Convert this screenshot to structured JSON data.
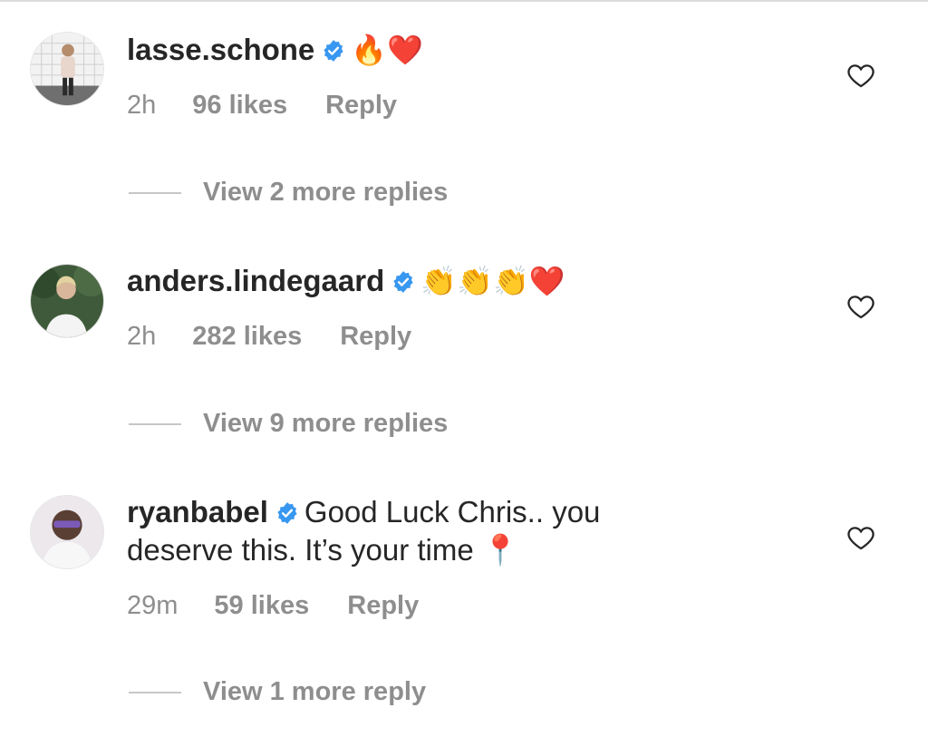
{
  "comments": [
    {
      "username": "lasse.schone",
      "verified": true,
      "text": "🔥❤️",
      "time": "2h",
      "likes": "96 likes",
      "reply_label": "Reply",
      "view_replies": "View 2 more replies"
    },
    {
      "username": "anders.lindegaard",
      "verified": true,
      "text": "👏👏👏❤️",
      "time": "2h",
      "likes": "282 likes",
      "reply_label": "Reply",
      "view_replies": "View 9 more replies"
    },
    {
      "username": "ryanbabel",
      "verified": true,
      "text": "Good Luck Chris.. you deserve this. It’s your time 📍",
      "time": "29m",
      "likes": "59 likes",
      "reply_label": "Reply",
      "view_replies": "View 1 more reply"
    }
  ],
  "icons": {
    "verified": "verified-badge-icon",
    "like": "heart-outline-icon"
  },
  "colors": {
    "text": "#262626",
    "muted": "#8e8e8e",
    "verified": "#3897f0"
  }
}
